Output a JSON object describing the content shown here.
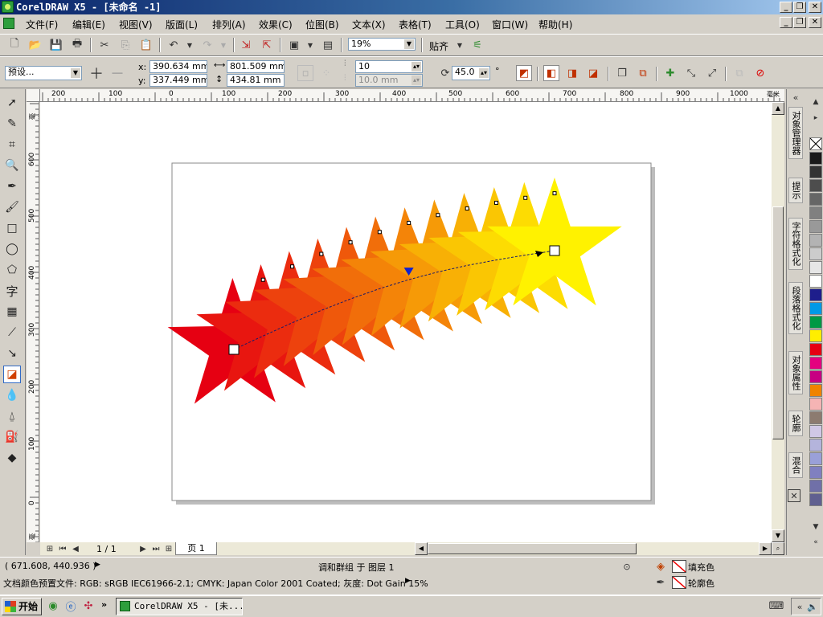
{
  "window": {
    "title": "CorelDRAW X5 - [未命名 -1]",
    "controls": {
      "minimize": "_",
      "restore": "❐",
      "close": "✕"
    }
  },
  "menu": [
    {
      "label": "文件(F)"
    },
    {
      "label": "编辑(E)"
    },
    {
      "label": "视图(V)"
    },
    {
      "label": "版面(L)"
    },
    {
      "label": "排列(A)"
    },
    {
      "label": "效果(C)"
    },
    {
      "label": "位图(B)"
    },
    {
      "label": "文本(X)"
    },
    {
      "label": "表格(T)"
    },
    {
      "label": "工具(O)"
    },
    {
      "label": "窗口(W)"
    },
    {
      "label": "帮助(H)"
    }
  ],
  "standard_toolbar": {
    "zoom": "19%",
    "snap_label": "贴齐"
  },
  "property_bar": {
    "preset": "预设...",
    "x_label": "x:",
    "x_value": "390.634 mm",
    "y_label": "y:",
    "y_value": "337.449 mm",
    "width_value": "801.509 mm",
    "height_value": "434.81 mm",
    "steps_value": "10",
    "spacing_value": "10.0 mm",
    "rotation_value": "45.0",
    "degree_symbol": "°"
  },
  "ruler": {
    "h_labels": [
      "200",
      "100",
      "0",
      "100",
      "200",
      "300",
      "400",
      "500",
      "600",
      "700",
      "800",
      "900",
      "1000"
    ],
    "h_unit": "毫米",
    "v_labels": [
      "600",
      "500",
      "400",
      "300",
      "200",
      "100",
      "0"
    ],
    "v_unit": "毫米"
  },
  "page_nav": {
    "page_counter": "1 / 1",
    "page_tab": "页 1"
  },
  "dockers": [
    {
      "label": "对象管理器",
      "icon": "object-manager-icon"
    },
    {
      "label": "提示",
      "icon": "hint-icon"
    },
    {
      "label": "字符格式化",
      "icon": "character-format-icon"
    },
    {
      "label": "段落格式化",
      "icon": "paragraph-format-icon"
    },
    {
      "label": "对象属性",
      "icon": "object-properties-icon"
    },
    {
      "label": "轮廓",
      "icon": "contour-icon"
    },
    {
      "label": "混合",
      "icon": "blend-icon"
    }
  ],
  "palette": [
    "#1a1a1a",
    "#333333",
    "#4d4d4d",
    "#666666",
    "#808080",
    "#999999",
    "#b3b3b3",
    "#cccccc",
    "#e6e6e6",
    "#ffffff",
    "#1e1e8c",
    "#0099e6",
    "#009944",
    "#ffee00",
    "#e60012",
    "#e4007f",
    "#c70082",
    "#f08300",
    "#f5b4b4",
    "#8c7b70",
    "#d0c8e6",
    "#b4b4dc",
    "#9aa0d8",
    "#8080c0",
    "#7070a8",
    "#606090"
  ],
  "status": {
    "cursor_position": "( 671.608, 440.936 )",
    "selection_info": "调和群组 于 图层 1",
    "fill_label": "填充色",
    "outline_label": "轮廓色",
    "color_profile": "文档颜色预置文件: RGB: sRGB IEC61966-2.1; CMYK: Japan Color 2001 Coated; 灰度: Dot Gain 15%"
  },
  "taskbar": {
    "start_label": "开始",
    "task_label": "CorelDRAW X5 - [未..."
  },
  "blend_colors": {
    "start": "#e60012",
    "end": "#fff200"
  }
}
